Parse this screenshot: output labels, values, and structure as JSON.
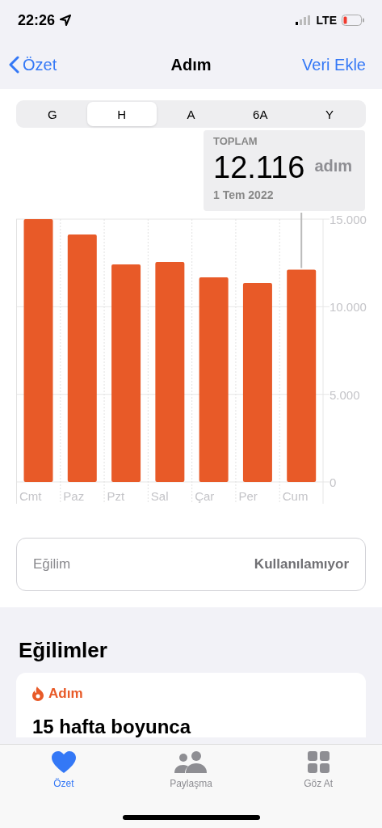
{
  "status_bar": {
    "time": "22:26",
    "network": "LTE"
  },
  "nav": {
    "back": "Özet",
    "title": "Adım",
    "action": "Veri Ekle"
  },
  "segments": [
    {
      "label": "G",
      "selected": false
    },
    {
      "label": "H",
      "selected": true
    },
    {
      "label": "A",
      "selected": false
    },
    {
      "label": "6A",
      "selected": false
    },
    {
      "label": "Y",
      "selected": false
    }
  ],
  "summary": {
    "caption": "TOPLAM",
    "value": "12.116",
    "unit": "adım",
    "date": "1 Tem 2022"
  },
  "chart_data": {
    "type": "bar",
    "categories": [
      "Cmt",
      "Paz",
      "Pzt",
      "Sal",
      "Çar",
      "Per",
      "Cum"
    ],
    "values": [
      15000,
      14120,
      12410,
      12550,
      11680,
      11350,
      12116
    ],
    "ylim": [
      0,
      15000
    ],
    "yticks": [
      {
        "value": 0,
        "label": "0"
      },
      {
        "value": 5000,
        "label": "5.000"
      },
      {
        "value": 10000,
        "label": "10.000"
      },
      {
        "value": 15000,
        "label": "15.000"
      }
    ],
    "color": "#e85a28",
    "annotations": [
      {
        "x": "Cum"
      }
    ]
  },
  "trend_row": {
    "label": "Eğilim",
    "value": "Kullanılamıyor"
  },
  "trends": {
    "heading": "Eğilimler",
    "card": {
      "category": "Adım",
      "title": "15 hafta boyunca"
    }
  },
  "tab_bar": [
    {
      "label": "Özet",
      "kind": "heart",
      "selected": true
    },
    {
      "label": "Paylaşma",
      "kind": "people",
      "selected": false
    },
    {
      "label": "Göz At",
      "kind": "grid",
      "selected": false
    }
  ]
}
